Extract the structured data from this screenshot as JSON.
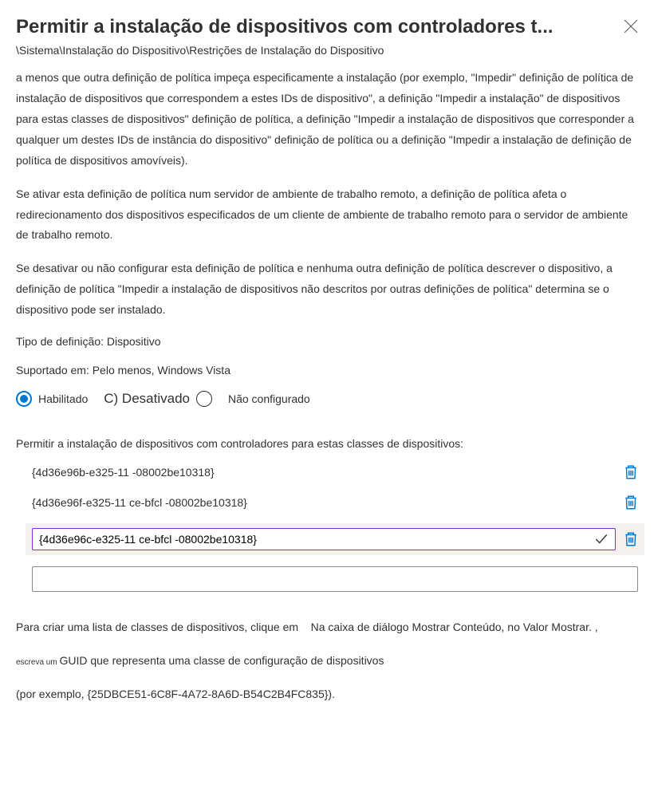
{
  "header": {
    "title": "Permitir a instalação de dispositivos com controladores t...",
    "breadcrumb": "\\Sistema\\Instalação do Dispositivo\\Restrições de Instalação do Dispositivo"
  },
  "description": {
    "p1": "a menos que outra definição de política impeça especificamente a instalação (por exemplo, \"Impedir\" definição de política de instalação de dispositivos que correspondem a estes IDs de dispositivo\", a definição \"Impedir a instalação\" de dispositivos para estas classes de dispositivos\" definição de política, a definição \"Impedir a instalação de dispositivos que corresponder a qualquer um destes IDs de instância do dispositivo\" definição de política ou a definição \"Impedir a instalação de definição de política de dispositivos amovíveis).",
    "p2": "Se ativar esta definição de política num servidor de ambiente de trabalho remoto, a definição de política afeta o redirecionamento dos dispositivos especificados de um cliente de ambiente de trabalho remoto para o servidor de ambiente de trabalho remoto.",
    "p3": "Se desativar ou não configurar esta definição de política e nenhuma outra definição de política descrever o dispositivo, a definição de política \"Impedir a instalação de dispositivos não descritos por outras definições de política\" determina se o dispositivo pode ser instalado."
  },
  "settingType": "Tipo de definição: Dispositivo",
  "supported": "Suportado em: Pelo menos, Windows Vista",
  "radio": {
    "enabled": "Habilitado",
    "disabled": "C) Desativado",
    "notConfigured": "Não configurado"
  },
  "listSection": {
    "label": "Permitir a instalação de dispositivos com controladores para estas classes de dispositivos:",
    "items": [
      "{4d36e96b-e325-11 -08002be10318}",
      "{4d36e96f-e325-11 ce-bfcl -08002be10318}"
    ],
    "editingValue": "{4d36e96c-e325-11 ce-bfcl -08002be10318}"
  },
  "helpText": {
    "line1a": "Para criar uma lista de classes de dispositivos, clique em ",
    "line1b": "Na caixa de diálogo Mostrar Conteúdo, no Valor Mostrar. ,",
    "line2a": "escreva um ",
    "line2b": "GUID que representa uma classe de configuração de dispositivos",
    "line3": "(por exemplo, {25DBCE51-6C8F-4A72-8A6D-B54C2B4FC835})."
  }
}
